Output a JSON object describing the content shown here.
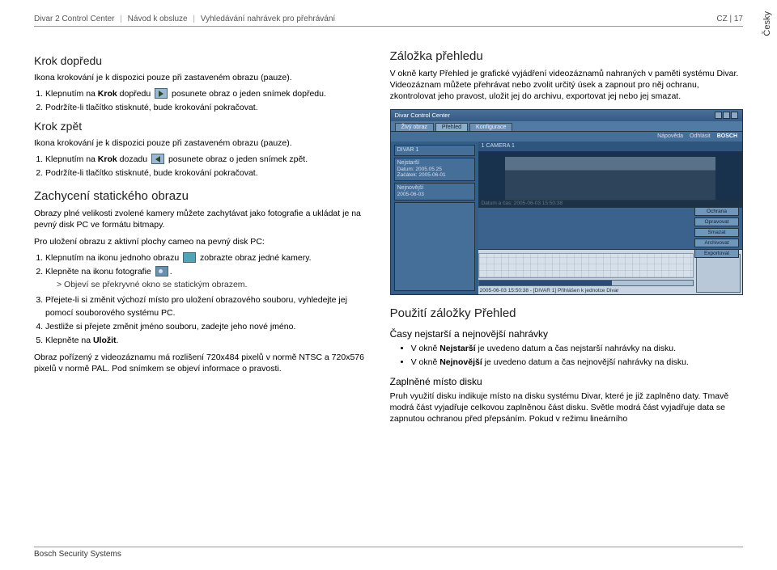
{
  "header": {
    "crumb1": "Divar 2 Control Center",
    "crumb2": "Návod k obsluze",
    "crumb3": "Vyhledávání nahrávek pro přehrávání",
    "lang": "CZ",
    "page": "17"
  },
  "lang_tab": "Česky",
  "left": {
    "h_fwd": "Krok dopředu",
    "fwd_p": "Ikona krokování je k dispozici pouze při zastaveném obrazu (pauze).",
    "fwd_li1_a": "Klepnutím na ",
    "fwd_li1_b": "Krok",
    "fwd_li1_c": " dopředu ",
    "fwd_li1_d": " posunete obraz o jeden snímek dopředu.",
    "fwd_li2": "Podržíte-li tlačítko stisknuté, bude krokování pokračovat.",
    "h_back": "Krok zpět",
    "back_p": "Ikona krokování je k dispozici pouze při zastaveném obrazu (pauze).",
    "back_li1_a": "Klepnutím na ",
    "back_li1_b": "Krok",
    "back_li1_c": " dozadu ",
    "back_li1_d": " posunete obraz o jeden snímek zpět.",
    "back_li2": "Podržíte-li tlačítko stisknuté, bude krokování pokračovat.",
    "h_cap": "Zachycení statického obrazu",
    "cap_p1": "Obrazy plné velikosti zvolené kamery můžete zachytávat jako fotografie a ukládat je na pevný disk PC ve formátu bitmapy.",
    "cap_p2": "Pro uložení obrazu z aktivní plochy cameo na pevný disk PC:",
    "cap_li1_a": "Klepnutím na ikonu jednoho obrazu ",
    "cap_li1_b": " zobrazte obraz jedné kamery.",
    "cap_li2_a": "Klepněte na ikonu fotografie ",
    "cap_li2_b": ".",
    "cap_li2_sub": "> Objeví se překryvné okno se statickým obrazem.",
    "cap_li3": "Přejete-li si změnit výchozí místo pro uložení obrazového souboru, vyhledejte jej pomocí souborového systému PC.",
    "cap_li4": "Jestliže si přejete změnit jméno souboru, zadejte jeho nové jméno.",
    "cap_li5_a": "Klepněte na ",
    "cap_li5_b": "Uložit",
    "cap_li5_c": ".",
    "cap_p3": "Obraz pořízený z videozáznamu má rozlišení 720x484 pixelů v normě NTSC a 720x576 pixelů v normě PAL. Pod snímkem se objeví informace o pravosti."
  },
  "right": {
    "h_over": "Záložka přehledu",
    "over_p": "V okně karty Přehled je grafické vyjádření videozáznamů nahraných v paměti systému Divar. Videozáznam můžete přehrávat nebo zvolit určitý úsek a zapnout pro něj ochranu, zkontrolovat jeho pravost, uložit jej do archivu, exportovat jej nebo jej smazat.",
    "app": {
      "title": "Divar Control Center",
      "tabs": [
        "Živý obraz",
        "Přehled",
        "Konfigurace"
      ],
      "toolbar": [
        "Nápověda",
        "Odhlásit"
      ],
      "brand": "BOSCH",
      "side_divar": "DIVAR 1",
      "camera_label": "1 CAMERA 1",
      "panel_old_title": "Nejstarší",
      "panel_old_r1": "Datum:",
      "panel_old_v1": "2005.05.25",
      "panel_old_r2": "Začátek:",
      "panel_old_v2": "2005-06-01",
      "panel_new_title": "Nejnovější",
      "panel_new_v1": "2005-06-03",
      "rbtns": [
        "Ochrana",
        "Opravovat",
        "Smazat",
        "Archivovat",
        "Exportovat"
      ],
      "caption": "Datum a čas: 2005-06-03 15:50:38",
      "status": "2005-06-03 15:50:38 - [DIVAR 1] Přihlášen k jednotce Divar"
    },
    "h_use": "Použití záložky Přehled",
    "h_times": "Časy nejstarší a nejnovější nahrávky",
    "li_old_a": "V okně ",
    "li_old_b": "Nejstarší",
    "li_old_c": " je uvedeno datum a čas nejstarší nahrávky na disku.",
    "li_new_a": "V okně ",
    "li_new_b": "Nejnovější",
    "li_new_c": " je uvedeno datum a čas nejnovější nahrávky na disku.",
    "h_disk": "Zaplněné místo disku",
    "disk_p": "Pruh využití disku indikuje místo na disku systému Divar, které je již zaplněno daty. Tmavě modrá část vyjadřuje celkovou zaplněnou část disku. Světle modrá část vyjadřuje data se zapnutou ochranou před přepsáním. Pokud v režimu lineárního"
  },
  "footer": "Bosch Security Systems"
}
